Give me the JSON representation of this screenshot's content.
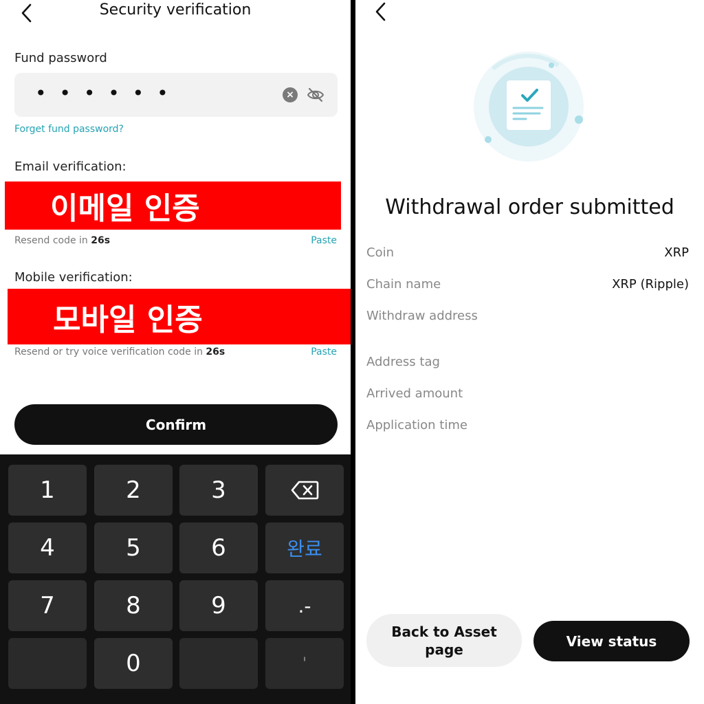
{
  "left": {
    "title": "Security verification",
    "fund_password": {
      "label": "Fund password",
      "masked_value": "• • • • • •",
      "forget_link": "Forget fund password?"
    },
    "email": {
      "label": "Email verification:",
      "banner": "이메일 인증",
      "resend_prefix": "Resend code in ",
      "countdown": "26s",
      "paste": "Paste"
    },
    "mobile": {
      "label": "Mobile verification:",
      "banner": "모바일 인증",
      "resend_prefix": "Resend or try voice verification code in ",
      "countdown": "26s",
      "paste": "Paste"
    },
    "confirm": "Confirm",
    "keypad": {
      "k1": "1",
      "k2": "2",
      "k3": "3",
      "k4": "4",
      "k5": "5",
      "k6": "6",
      "k7": "7",
      "k8": "8",
      "k9": "9",
      "k0": "0",
      "done": "완료",
      "dot_minus": ".-",
      "apostrophe": "'"
    }
  },
  "right": {
    "title": "Withdrawal order submitted",
    "rows": [
      {
        "label": "Coin",
        "value": "XRP"
      },
      {
        "label": "Chain name",
        "value": "XRP (Ripple)"
      },
      {
        "label": "Withdraw address",
        "value": ""
      },
      {
        "label": "Address tag",
        "value": ""
      },
      {
        "label": "Arrived amount",
        "value": ""
      },
      {
        "label": "Application time",
        "value": ""
      }
    ],
    "back_button": "Back to Asset page",
    "view_status": "View status"
  },
  "colors": {
    "accent_teal": "#24a3b3",
    "redaction_red": "#ff0000",
    "keypad_done_blue": "#3b8ff0"
  }
}
